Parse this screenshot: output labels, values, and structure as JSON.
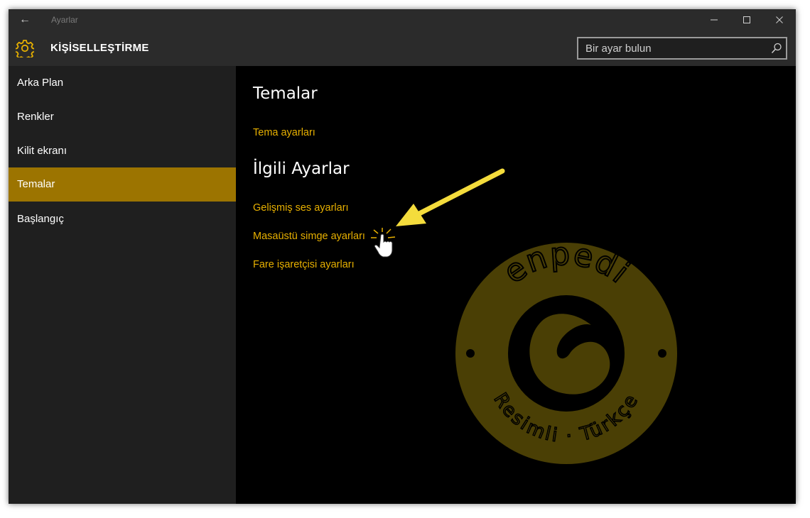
{
  "window": {
    "title": "Ayarlar",
    "back_glyph": "←",
    "icons": {
      "back": "back-arrow-icon",
      "minimize": "minimize-icon",
      "maximize": "maximize-icon",
      "close": "close-icon"
    }
  },
  "header": {
    "title": "KİŞİSELLEŞTİRME",
    "icon": "gear-icon",
    "search": {
      "placeholder": "Bir ayar bulun",
      "value": "",
      "icon": "search-icon"
    }
  },
  "sidebar": {
    "items": [
      {
        "label": "Arka Plan",
        "selected": false
      },
      {
        "label": "Renkler",
        "selected": false
      },
      {
        "label": "Kilit ekranı",
        "selected": false
      },
      {
        "label": "Temalar",
        "selected": true
      },
      {
        "label": "Başlangıç",
        "selected": false
      }
    ]
  },
  "main": {
    "sections": [
      {
        "title": "Temalar",
        "links": [
          "Tema ayarları"
        ]
      },
      {
        "title": "İlgili Ayarlar",
        "links": [
          "Gelişmiş ses ayarları",
          "Masaüstü simge ayarları",
          "Fare işaretçisi ayarları"
        ]
      }
    ]
  },
  "overlay": {
    "annotation_arrow": "yellow-arrow-icon",
    "cursor": "hand-cursor-icon",
    "watermark": {
      "top_text": "enpedi",
      "bottom_text_left": "Resimli",
      "bottom_text_right": "Türkçe"
    }
  },
  "colors": {
    "accent": "#9c7400",
    "link": "#e7b000",
    "arrow": "#f4dc3c",
    "watermark_fill": "#4a3f05"
  }
}
